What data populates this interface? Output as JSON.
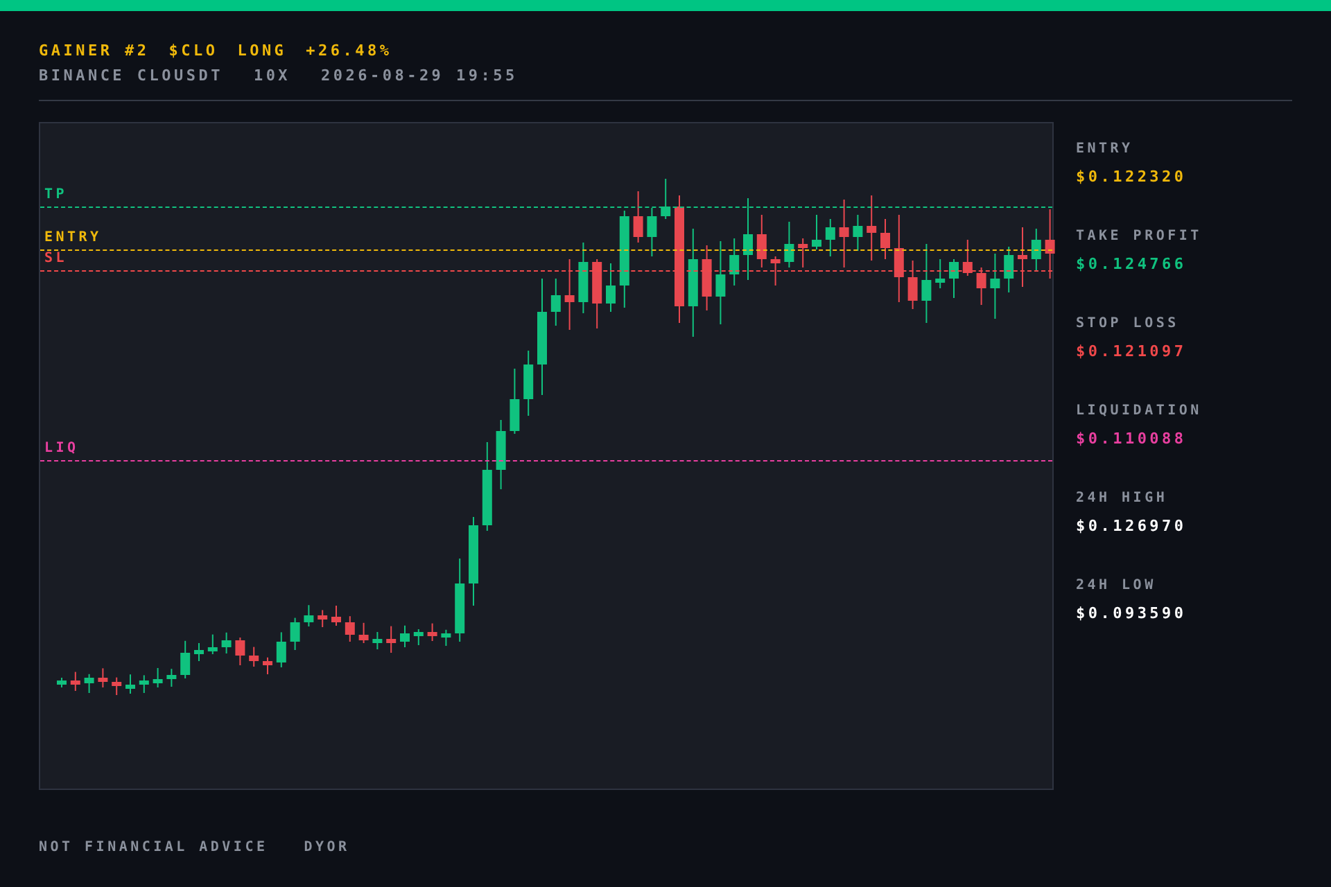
{
  "header": {
    "title_parts": [
      "GAINER #2",
      "$CLO",
      "LONG",
      "+26.48%"
    ],
    "meta_parts": [
      "BINANCE CLOUSDT",
      "10X",
      "2026-08-29 19:55"
    ]
  },
  "chart": {
    "levels": [
      {
        "kind": "tp",
        "label": "TP",
        "color": "#10c27f"
      },
      {
        "kind": "entry",
        "label": "ENTRY",
        "color": "#f0b90b"
      },
      {
        "kind": "sl",
        "label": "SL",
        "color": "#f0484a"
      },
      {
        "kind": "liq",
        "label": "LIQ",
        "color": "#e93fa0"
      }
    ]
  },
  "stats": [
    {
      "label": "ENTRY",
      "value": "$0.122320",
      "color": "#f0b90b"
    },
    {
      "label": "TAKE PROFIT",
      "value": "$0.124766",
      "color": "#10c27f"
    },
    {
      "label": "STOP LOSS",
      "value": "$0.121097",
      "color": "#f0484a"
    },
    {
      "label": "LIQUIDATION",
      "value": "$0.110088",
      "color": "#e93fa0"
    },
    {
      "label": "24H HIGH",
      "value": "$0.126970",
      "color": "#ffffff"
    },
    {
      "label": "24H LOW",
      "value": "$0.093590",
      "color": "#ffffff"
    }
  ],
  "footer": [
    "NOT FINANCIAL ADVICE",
    "DYOR"
  ]
}
